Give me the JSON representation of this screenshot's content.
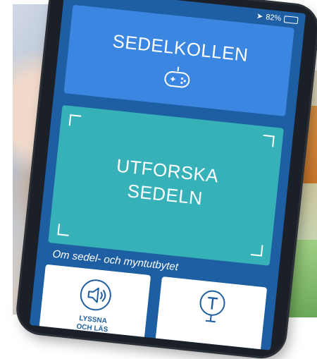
{
  "status_bar": {
    "battery_text": "82%",
    "battery_level": 0.82
  },
  "tiles": {
    "game": {
      "title": "SEDELKOLLEN",
      "icon": "gamepad-icon"
    },
    "explore": {
      "title_line1": "UTFORSKA",
      "title_line2": "SEDELN"
    }
  },
  "section": {
    "label": "Om sedel- och myntutbytet"
  },
  "cards": {
    "listen": {
      "label_line1": "LYSSNA",
      "label_line2": "OCH LÄS",
      "icon": "speaker-icon"
    },
    "second": {
      "icon": "info-sign-icon"
    }
  },
  "colors": {
    "screen_bg": "#1e5fa3",
    "tile_game": "#3b86e0",
    "tile_explore": "#36b1b8",
    "card_bg": "#ffffff",
    "accent": "#1e5fa3"
  }
}
